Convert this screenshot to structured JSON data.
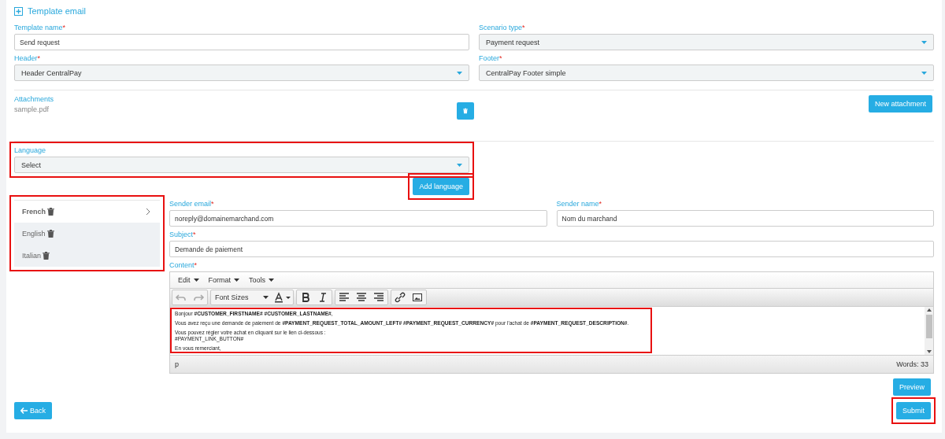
{
  "section_title": "Template email",
  "fields_left": [
    {
      "label": "Template name",
      "required_mark": "*",
      "kind": "input",
      "value": "Send request"
    },
    {
      "label": "Header",
      "required_mark": "*",
      "kind": "select",
      "value": "Header CentralPay"
    }
  ],
  "fields_right": [
    {
      "label": "Scenario type",
      "required_mark": "*",
      "kind": "select",
      "value": "Payment request"
    },
    {
      "label": "Footer",
      "required_mark": "*",
      "kind": "select",
      "value": "CentralPay Footer simple"
    }
  ],
  "attachments": {
    "label": "Attachments",
    "files": [
      "sample.pdf"
    ],
    "new_button": "New attachment"
  },
  "language": {
    "label": "Language",
    "value": "Select",
    "highlighted": true,
    "add_button": "Add language",
    "add_highlighted": true
  },
  "language_list": {
    "highlighted": true,
    "items": [
      {
        "label": "French",
        "selected": true
      },
      {
        "label": "English",
        "selected": false
      },
      {
        "label": "Italian",
        "selected": false
      }
    ]
  },
  "sender_email": {
    "label": "Sender email",
    "required_mark": "*",
    "value": "noreply@domainemarchand.com"
  },
  "sender_name": {
    "label": "Sender name",
    "required_mark": "*",
    "value": "Nom du marchand"
  },
  "subject": {
    "label": "Subject",
    "required_mark": "*",
    "value": "Demande de paiement"
  },
  "content": {
    "label": "Content",
    "required_mark": "*",
    "menus": [
      "Edit",
      "Format",
      "Tools"
    ],
    "font_sizes": "Font Sizes",
    "body_highlighted": true,
    "paragraphs": [
      "Bonjour **#CUSTOMER_FIRSTNAME# #CUSTOMER_LASTNAME#**,",
      "Vous avez reçu une demande de paiement de **#PAYMENT_REQUEST_TOTAL_AMOUNT_LEFT# #PAYMENT_REQUEST_CURRENCY#** pour l'achat de **#PAYMENT_REQUEST_DESCRIPTION#**.",
      "Vous pouvez régler votre achat en cliquant sur le lien ci-dessous :",
      "#PAYMENT_LINK_BUTTON#",
      "En vous remerciant,"
    ],
    "path": "p",
    "word_count": "Words: 33"
  },
  "preview_button": "Preview",
  "back_button": "Back",
  "submit": {
    "label": "Submit",
    "highlighted": true
  }
}
